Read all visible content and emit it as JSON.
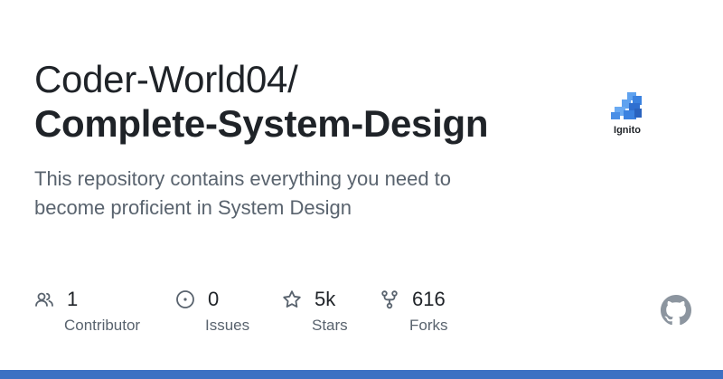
{
  "repo": {
    "owner": "Coder-World04/",
    "name": "Complete-System-Design",
    "description": "This repository contains everything you need to become proficient in System Design"
  },
  "logo": {
    "text": "Ignito",
    "icon": "stacked-blocks-logo"
  },
  "stats": [
    {
      "icon": "people-icon",
      "value": "1",
      "label": "Contributor"
    },
    {
      "icon": "issue-icon",
      "value": "0",
      "label": "Issues"
    },
    {
      "icon": "star-icon",
      "value": "5k",
      "label": "Stars"
    },
    {
      "icon": "fork-icon",
      "value": "616",
      "label": "Forks"
    }
  ],
  "colors": {
    "text": "#1f2328",
    "muted": "#59636e",
    "accent_bar": "#3c71c3",
    "logo_blue": "#3b82e0"
  }
}
